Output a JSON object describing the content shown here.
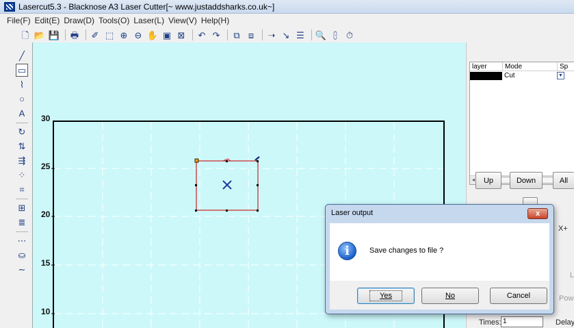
{
  "window": {
    "title": "Lasercut5.3 - Blacknose A3 Laser Cutter[~ www.justaddsharks.co.uk~]",
    "app_icon": "lasercut-app-icon"
  },
  "menu": [
    "File(F)",
    "Edit(E)",
    "Draw(D)",
    "Tools(O)",
    "Laser(L)",
    "View(V)",
    "Help(H)"
  ],
  "toolbar": [
    {
      "name": "new-file-icon",
      "glyph": "🗋"
    },
    {
      "name": "open-folder-icon",
      "glyph": "📂"
    },
    {
      "name": "save-disk-icon",
      "glyph": "💾"
    },
    {
      "sep": true
    },
    {
      "name": "print-icon",
      "glyph": "🖶"
    },
    {
      "sep": true
    },
    {
      "name": "node-edit-icon",
      "glyph": "✐"
    },
    {
      "name": "select-zoom-icon",
      "glyph": "⬚"
    },
    {
      "name": "zoom-in-icon",
      "glyph": "⊕"
    },
    {
      "name": "zoom-out-icon",
      "glyph": "⊖"
    },
    {
      "name": "pan-hand-icon",
      "glyph": "✋"
    },
    {
      "name": "zoom-page-icon",
      "glyph": "▣"
    },
    {
      "name": "zoom-fit-icon",
      "glyph": "⊠"
    },
    {
      "sep": true
    },
    {
      "name": "undo-icon",
      "glyph": "↶"
    },
    {
      "name": "redo-icon",
      "glyph": "↷"
    },
    {
      "sep": true
    },
    {
      "name": "group-icon",
      "glyph": "⧉"
    },
    {
      "name": "ungroup-icon",
      "glyph": "⧈"
    },
    {
      "sep": true
    },
    {
      "name": "cut-path-arrow-icon",
      "glyph": "➝"
    },
    {
      "name": "line-direction-icon",
      "glyph": "↘"
    },
    {
      "name": "layers-list-icon",
      "glyph": "☰"
    },
    {
      "sep": true
    },
    {
      "name": "print-preview-icon",
      "glyph": "🔍"
    },
    {
      "name": "laser-head-icon",
      "glyph": "⩉"
    },
    {
      "name": "timer-icon",
      "glyph": "⏱"
    }
  ],
  "left_tools": [
    {
      "name": "line-tool-icon",
      "glyph": "╱",
      "active": false
    },
    {
      "name": "rectangle-tool-icon",
      "glyph": "▭",
      "active": true
    },
    {
      "name": "polyline-tool-icon",
      "glyph": "⌇",
      "active": false
    },
    {
      "name": "ellipse-tool-icon",
      "glyph": "○",
      "active": false
    },
    {
      "name": "text-tool-icon",
      "glyph": "A",
      "active": false
    },
    {
      "sep": true
    },
    {
      "name": "rotate-tool-icon",
      "glyph": "↻",
      "active": false
    },
    {
      "name": "mirror-tool-icon",
      "glyph": "⇅",
      "active": false
    },
    {
      "name": "align-tool-icon",
      "glyph": "⇶",
      "active": false
    },
    {
      "name": "scatter-tool-icon",
      "glyph": "⁘",
      "active": false
    },
    {
      "name": "array-tool-icon",
      "glyph": "⌗",
      "active": false
    },
    {
      "sep": true
    },
    {
      "name": "grid-array-tool-icon",
      "glyph": "⊞",
      "active": false
    },
    {
      "name": "hatch-tool-icon",
      "glyph": "≣",
      "active": false
    },
    {
      "sep": true
    },
    {
      "name": "offset-tool-icon",
      "glyph": "⋯",
      "active": false
    },
    {
      "name": "stamp-tool-icon",
      "glyph": "⛀",
      "active": false
    },
    {
      "name": "curve-tool-icon",
      "glyph": "∼",
      "active": false
    }
  ],
  "canvas": {
    "background": "#ccf8fa",
    "y_labels": [
      "30",
      "25",
      "20",
      "15",
      "10"
    ]
  },
  "layer_panel": {
    "headers": [
      "layer",
      "Mode",
      "Sp"
    ],
    "row": {
      "color": "#000000",
      "mode": "Cut"
    },
    "scroll_glyph": "III"
  },
  "right_buttons": {
    "up": "Up",
    "down": "Down",
    "all": "All",
    "xplus": "X+",
    "l_partial": "L",
    "pow_partial": "Pow",
    "times_label": "Times:",
    "times_value": "1",
    "delay_label": "Delay"
  },
  "dialog": {
    "title": "Laser output",
    "close": "x",
    "message": "Save changes to file ?",
    "yes": "Yes",
    "no": "No",
    "cancel": "Cancel"
  }
}
